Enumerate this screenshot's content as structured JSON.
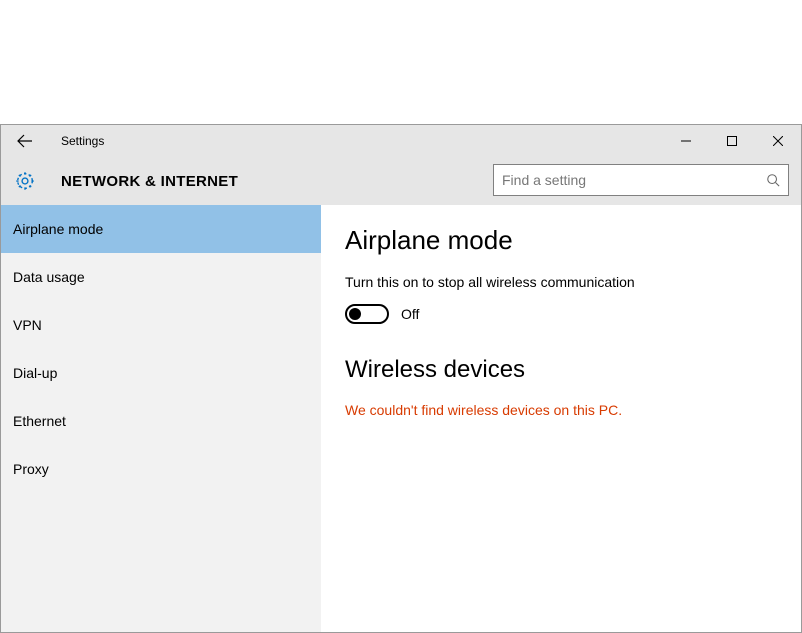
{
  "window": {
    "title": "Settings"
  },
  "header": {
    "title": "NETWORK & INTERNET"
  },
  "search": {
    "placeholder": "Find a setting"
  },
  "sidebar": {
    "items": [
      {
        "label": "Airplane mode",
        "selected": true
      },
      {
        "label": "Data usage",
        "selected": false
      },
      {
        "label": "VPN",
        "selected": false
      },
      {
        "label": "Dial-up",
        "selected": false
      },
      {
        "label": "Ethernet",
        "selected": false
      },
      {
        "label": "Proxy",
        "selected": false
      }
    ]
  },
  "content": {
    "heading": "Airplane mode",
    "description": "Turn this on to stop all wireless communication",
    "toggle_state": "Off",
    "sub_heading": "Wireless devices",
    "error_message": "We couldn't find wireless devices on this PC."
  }
}
